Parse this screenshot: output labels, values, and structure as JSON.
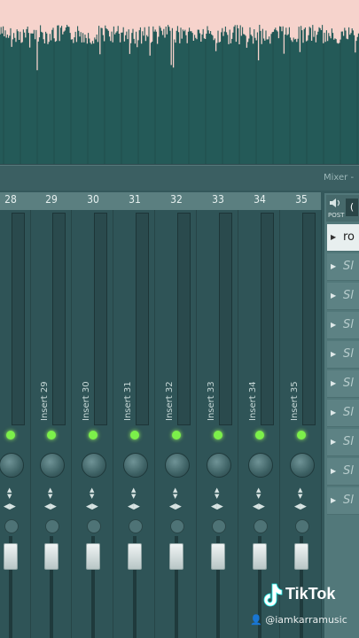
{
  "waveform": {
    "color": "#f6d3cc",
    "background": "#245a58"
  },
  "mixer": {
    "title": "Mixer -",
    "channels": [
      {
        "number": "28",
        "label": ""
      },
      {
        "number": "29",
        "label": "Insert 29"
      },
      {
        "number": "30",
        "label": "Insert 30"
      },
      {
        "number": "31",
        "label": "Insert 31"
      },
      {
        "number": "32",
        "label": "Insert 32"
      },
      {
        "number": "33",
        "label": "Insert 33"
      },
      {
        "number": "34",
        "label": "Insert 34"
      },
      {
        "number": "35",
        "label": "Insert 35"
      }
    ]
  },
  "right_panel": {
    "post_label": "POST",
    "top_button": "(",
    "slots": [
      "ro",
      "Sl",
      "Sl",
      "Sl",
      "Sl",
      "Sl",
      "Sl",
      "Sl",
      "Sl",
      "Sl"
    ]
  },
  "watermark": {
    "app": "TikTok",
    "username": "@iamkarramusic"
  }
}
